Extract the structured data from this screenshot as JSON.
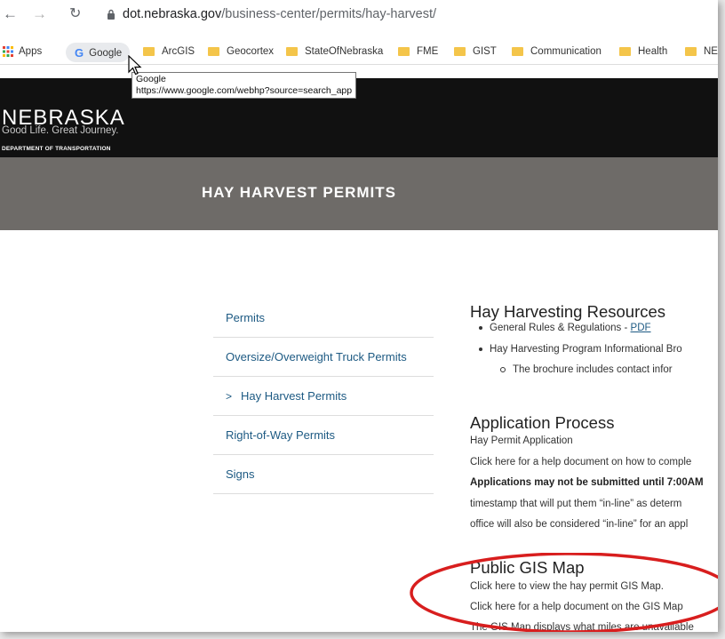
{
  "browser": {
    "url_domain": "dot.nebraska.gov",
    "url_path": "/business-center/permits/hay-harvest/",
    "bookmarks": [
      {
        "label": "Apps",
        "icon": "apps-grid-icon"
      },
      {
        "label": "Google",
        "icon": "google-icon"
      },
      {
        "label": "ArcGIS",
        "icon": "folder-icon"
      },
      {
        "label": "Geocortex",
        "icon": "folder-icon"
      },
      {
        "label": "StateOfNebraska",
        "icon": "folder-icon"
      },
      {
        "label": "FME",
        "icon": "folder-icon"
      },
      {
        "label": "GIST",
        "icon": "folder-icon"
      },
      {
        "label": "Communication",
        "icon": "folder-icon"
      },
      {
        "label": "Health",
        "icon": "folder-icon"
      },
      {
        "label": "NEW",
        "icon": "folder-icon"
      }
    ],
    "tooltip_title": "Google",
    "tooltip_url": "https://www.google.com/webhp?source=search_app"
  },
  "site": {
    "logo_name": "NEBRASKA",
    "logo_tagline": "Good Life. Great Journey.",
    "logo_dept": "DEPARTMENT OF TRANSPORTATION",
    "banner_title": "HAY HARVEST PERMITS"
  },
  "sidenav": {
    "items": [
      {
        "label": "Permits"
      },
      {
        "label": "Oversize/Overweight Truck Permits"
      },
      {
        "label": "Hay Harvest Permits",
        "active": true
      },
      {
        "label": "Right-of-Way Permits"
      },
      {
        "label": "Signs"
      }
    ]
  },
  "content": {
    "resources_heading": "Hay Harvesting Resources",
    "resource_1": "General Rules & Regulations - ",
    "resource_1_link": "PDF",
    "resource_2": "Hay Harvesting Program Informational Bro",
    "resource_2_sub": "The brochure includes contact infor",
    "application_heading": "Application Process",
    "app_line_1": "Hay Permit Application",
    "app_line_2": "Click here for a help document on how to comple",
    "app_line_3": "Applications may not be submitted until 7:00AM",
    "app_line_4": "timestamp that will put them “in-line” as determ",
    "app_line_5": "office will also be considered “in-line” for an appl",
    "gis_heading": "Public GIS Map",
    "gis_line_1": "Click here to view the hay permit GIS Map.",
    "gis_line_2": "Click here for a help document on the GIS Map",
    "gis_line_3": "The GIS Map displays what miles are unavailable"
  },
  "colors": {
    "header_bg": "#111111",
    "banner_bg": "#6e6b68",
    "link": "#1d5a83",
    "annotation_circle": "#d81e1e"
  }
}
